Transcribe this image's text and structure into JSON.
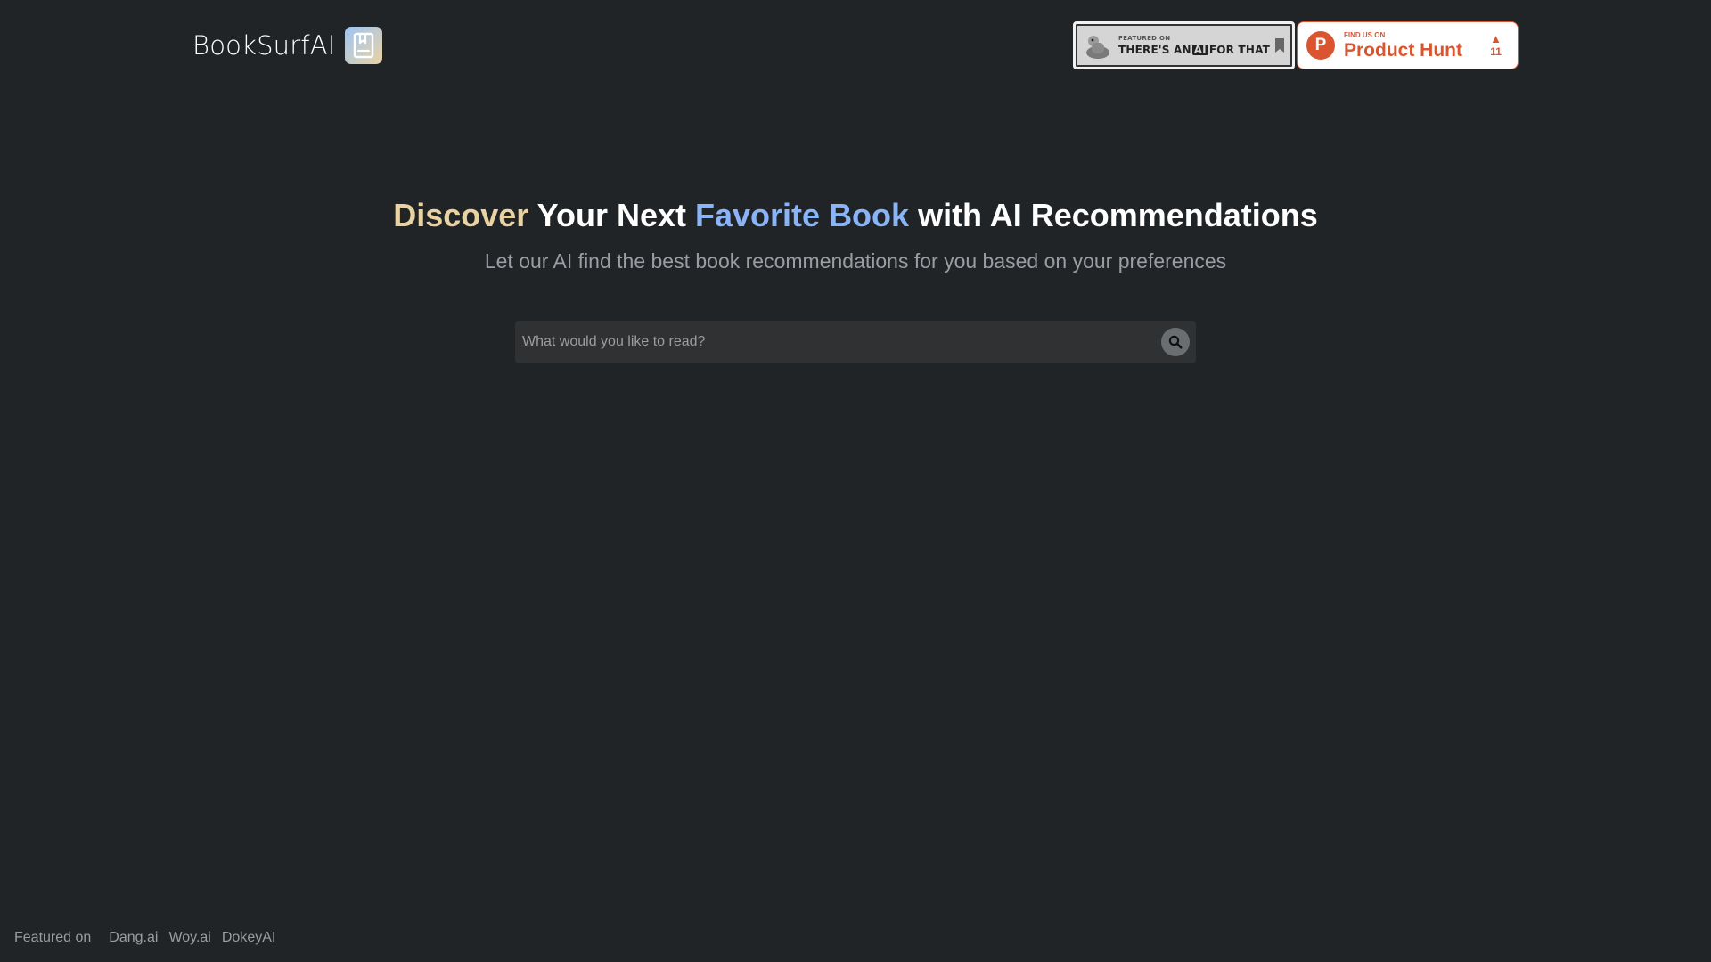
{
  "header": {
    "brand_name": "BookSurfAI",
    "logo_icon": "book-bookmark-icon",
    "badges": {
      "aift": {
        "small": "FEATURED ON",
        "big_prefix": "THERE'S AN",
        "big_ai": "AI",
        "big_suffix": "FOR THAT"
      },
      "product_hunt": {
        "letter": "P",
        "small": "FIND US ON",
        "big": "Product Hunt",
        "arrow": "▲",
        "votes": "11"
      }
    }
  },
  "hero": {
    "title_part1": "Discover",
    "title_part2": " Your Next ",
    "title_part3": "Favorite Book",
    "title_part4": " with AI Recommendations",
    "subtitle": "Let our AI find the best book recommendations for you based on your preferences"
  },
  "search": {
    "placeholder": "What would you like to read?",
    "value": ""
  },
  "footer": {
    "label": "Featured on",
    "links": [
      "Dang.ai",
      "Woy.ai",
      "DokeyAI"
    ]
  },
  "colors": {
    "background": "#212426",
    "gold": "#e9d3a2",
    "blue": "#8ab4f8",
    "product_hunt": "#da552f"
  }
}
